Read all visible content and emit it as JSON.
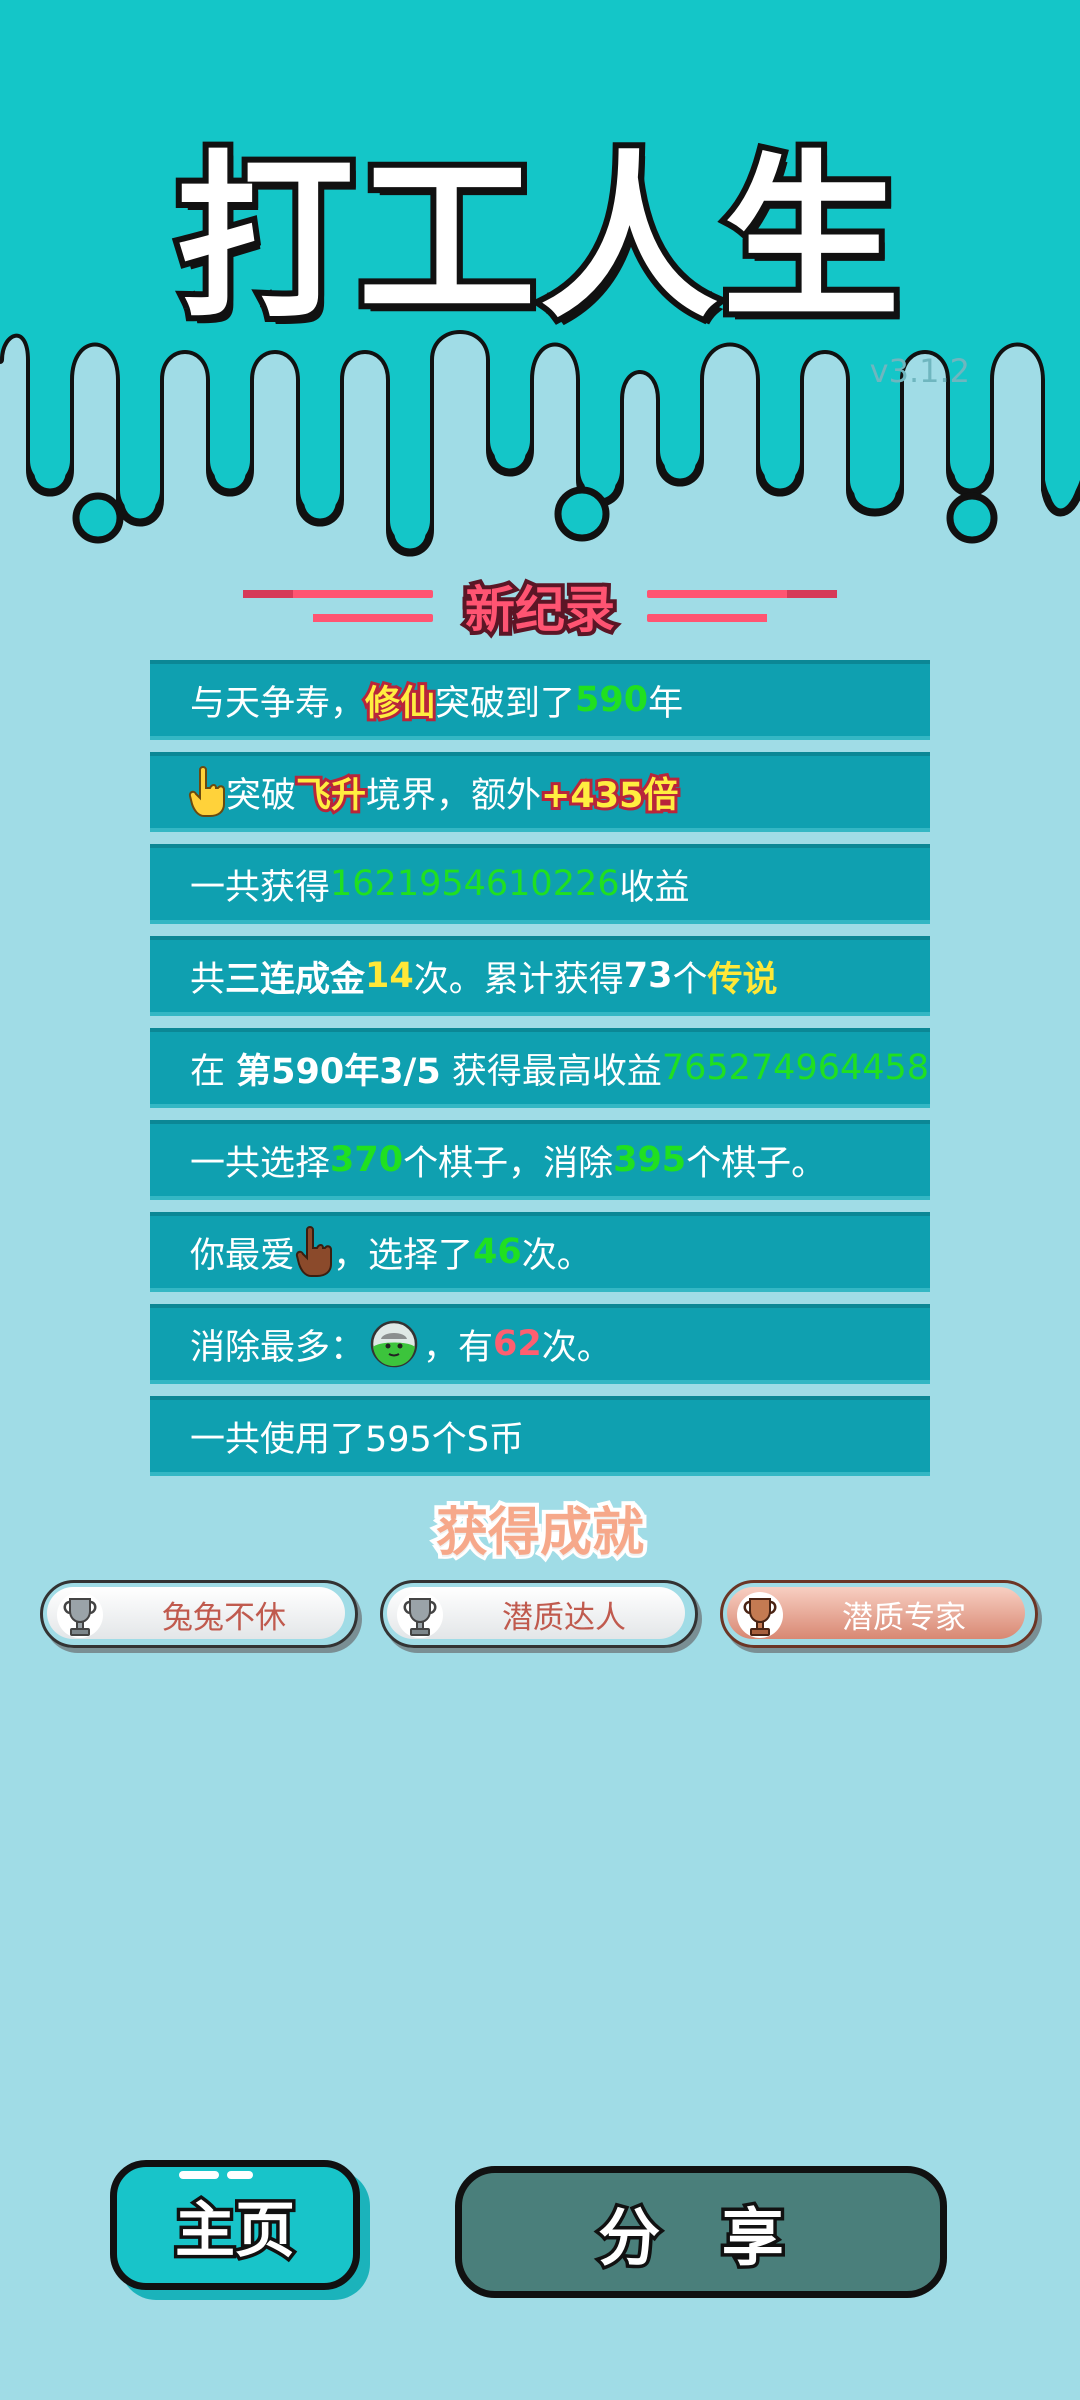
{
  "app": {
    "title": "打工人生",
    "version": "v3.1.2"
  },
  "record": {
    "heading": "新纪录"
  },
  "stats": {
    "r1": {
      "a": "与天争寿，",
      "b": "修仙",
      "c": "突破到了",
      "d": "590",
      "e": "年"
    },
    "r2": {
      "a": "突破",
      "b": "飞升",
      "c": "境界，额外",
      "d": "+435倍"
    },
    "r3": {
      "a": "一共获得",
      "b": "1621954610226",
      "c": "收益"
    },
    "r4": {
      "a": "共",
      "b": "三连成金",
      "c": "14",
      "d": "次。累计获得",
      "e": "73",
      "f": "个",
      "g": "传说"
    },
    "r5": {
      "a": "在 ",
      "b": "第590年3/5",
      "c": " 获得最高收益",
      "d": "765274964458"
    },
    "r6": {
      "a": "一共选择",
      "b": "370",
      "c": "个棋子，消除",
      "d": "395",
      "e": "个棋子。"
    },
    "r7": {
      "a": "你最爱",
      "b": "，选择了",
      "c": "46",
      "d": "次。"
    },
    "r8": {
      "a": "消除最多：",
      "b": "，有",
      "c": "62",
      "d": "次。"
    },
    "r9": {
      "a": "一共使用了595个S币"
    }
  },
  "achievements": {
    "title": "获得成就",
    "items": [
      {
        "label": "兔兔不休",
        "tier": "silver"
      },
      {
        "label": "潜质达人",
        "tier": "silver"
      },
      {
        "label": "潜质专家",
        "tier": "bronze"
      }
    ]
  },
  "buttons": {
    "home": "主页",
    "share": "分 享"
  },
  "colors": {
    "header": "#14c6c8",
    "background": "#a0dce6",
    "row": "#0fa0b0",
    "highlight_green": "#20e020",
    "highlight_yellow": "#ffe838",
    "highlight_red": "#ff5f70"
  },
  "icons": {
    "row2": "pointing-hand-icon",
    "row7": "pointing-hand-icon",
    "row8": "zombie-face-piece-icon",
    "trophy": "trophy-icon"
  }
}
